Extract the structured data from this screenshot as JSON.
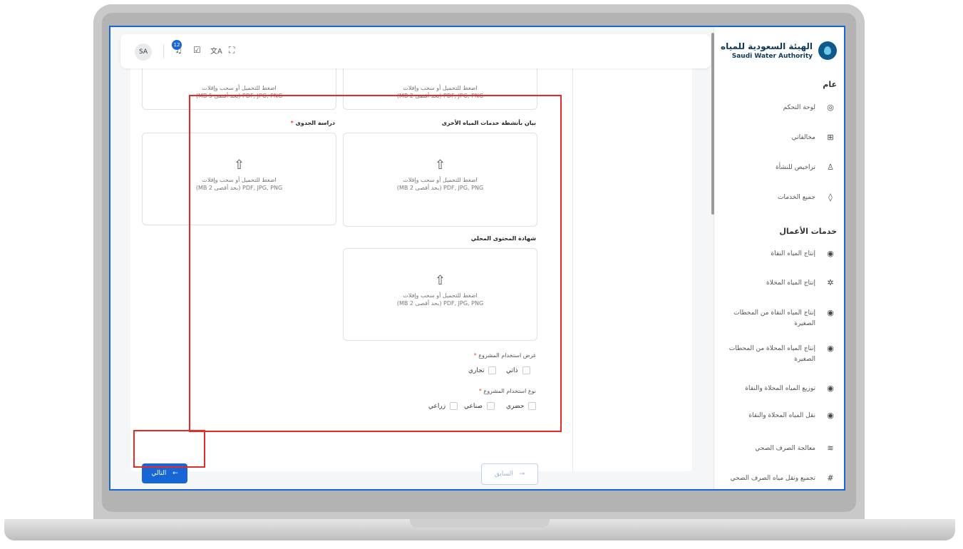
{
  "app": {
    "org_ar": "الهيئة السعودية للمياه",
    "org_en": "Saudi Water Authority"
  },
  "topbar": {
    "avatar": "SA",
    "notifications_count": "12",
    "icons": [
      "bell-icon",
      "clipboard-check-icon",
      "translate-icon",
      "fullscreen-icon"
    ]
  },
  "sidebar": {
    "section_general": "عام",
    "general_items": [
      {
        "label": "لوحة التحكم",
        "icon": "dashboard-icon"
      },
      {
        "label": "مخالفاتي",
        "icon": "grid-icon"
      },
      {
        "label": "تراخيص للنشأة",
        "icon": "user-icon"
      },
      {
        "label": "جميع الخدمات",
        "icon": "drop-icon"
      }
    ],
    "section_business": "خدمات الأعمال",
    "business_items": [
      {
        "label": "إنتاج المياه النقاة",
        "icon": "water-drop-icon"
      },
      {
        "label": "إنتاج المياه المحلاة",
        "icon": "sun-icon"
      },
      {
        "label": "إنتاج المياه النقاة من المحطات الصغيرة",
        "icon": "water-drop-icon"
      },
      {
        "label": "إنتاج المياه المحلاة من المحطات الصغيرة",
        "icon": "water-drop-icon"
      },
      {
        "label": "توزيع المياه المحلاة والنقاة",
        "icon": "water-drop-icon"
      },
      {
        "label": "نقل المياه المحلاة والنقاة",
        "icon": "water-drop-icon"
      },
      {
        "label": "معالجة الصرف الصحي",
        "icon": "waves-icon"
      },
      {
        "label": "تجميع ونقل مياه الصرف الصحي",
        "icon": "hash-icon"
      }
    ]
  },
  "form": {
    "top_right_hint1": "اضغط للتحميل أو سحب وإفلات",
    "top_right_hint2": "(MB 2 بحد أقصى) PDF, JPG, PNG",
    "top_left_hint1": "اضغط للتحميل أو سحب وإفلات",
    "top_left_hint2": "(MB 5 بحد أقصى) PDF, JPG, PNG",
    "field_other_activities": "بيان بأنشطة خدمات المياه الأخرى",
    "field_feasibility": "دراسة الجدوى",
    "field_local_content": "شهادة المحتوى المحلي",
    "upload_hint": "اضغط للتحميل أو سحب وإفلات",
    "upload_formats": "(MB 2 بحد أقصى) PDF, JPG, PNG",
    "purpose_label": "غرض استخدام المشروع",
    "purpose_options": [
      "ذاتي",
      "تجاري"
    ],
    "type_label": "نوع استخدام المشروع",
    "type_options": [
      "حضري",
      "صناعي",
      "زراعي"
    ],
    "required_mark": "*"
  },
  "buttons": {
    "next": "التالي",
    "previous": "السابق",
    "next_arrow": "←",
    "prev_arrow": "→"
  },
  "colors": {
    "primary": "#1766d6",
    "highlight": "#e62a2a"
  }
}
